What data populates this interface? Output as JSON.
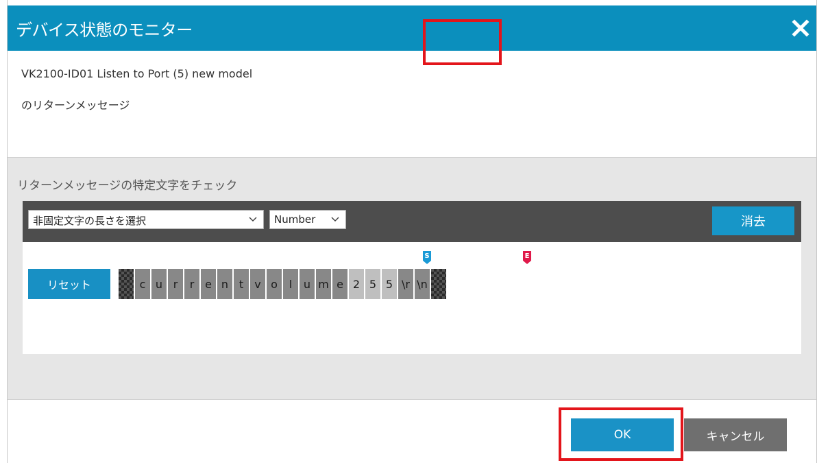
{
  "dialog": {
    "title": "デバイス状態のモニター",
    "description_line1": "VK2100-ID01 Listen to Port (5) new model",
    "description_line2": "のリターンメッセージ"
  },
  "check_section": {
    "title": "リターンメッセージの特定文字をチェック",
    "length_select": "非固定文字の長さを選択",
    "type_select": "Number",
    "clear_label": "消去",
    "reset_label": "リセット",
    "start_marker": "S",
    "end_marker": "E",
    "chars": [
      "c",
      "u",
      "r",
      "r",
      "e",
      "n",
      "t",
      "v",
      "o",
      "l",
      "u",
      "m",
      "e",
      "2",
      "5",
      "5",
      "\\r",
      "\\n"
    ]
  },
  "footer": {
    "ok_label": "OK",
    "cancel_label": "キャンセル"
  },
  "colors": {
    "titlebar": "#0b8fbd",
    "accent_button": "#1a92c6",
    "highlight_red": "#e3151b",
    "start_marker": "#1a9ad6",
    "end_marker": "#e0194a"
  }
}
